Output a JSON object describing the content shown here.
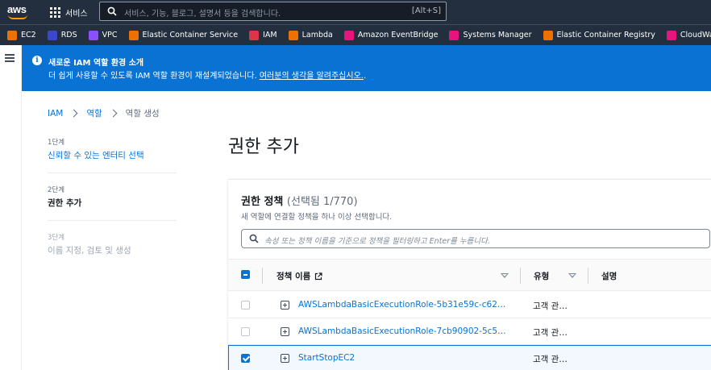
{
  "topnav": {
    "logo_text": "aws",
    "services_label": "서비스",
    "search_placeholder": "서비스, 기능, 블로그, 설명서 등을 검색합니다.",
    "search_shortcut": "[Alt+S]"
  },
  "favorites": [
    {
      "label": "EC2",
      "icon": "ec2-icon",
      "color": "#ed7100"
    },
    {
      "label": "RDS",
      "icon": "rds-icon",
      "color": "#3b48cc"
    },
    {
      "label": "VPC",
      "icon": "vpc-icon",
      "color": "#8c4fff"
    },
    {
      "label": "Elastic Container Service",
      "icon": "ecs-icon",
      "color": "#ed7100"
    },
    {
      "label": "IAM",
      "icon": "iam-icon",
      "color": "#dd344c"
    },
    {
      "label": "Lambda",
      "icon": "lambda-icon",
      "color": "#ed7100"
    },
    {
      "label": "Amazon EventBridge",
      "icon": "eventbridge-icon",
      "color": "#e7157b"
    },
    {
      "label": "Systems Manager",
      "icon": "systems-manager-icon",
      "color": "#e7157b"
    },
    {
      "label": "Elastic Container Registry",
      "icon": "ecr-icon",
      "color": "#ed7100"
    },
    {
      "label": "CloudWatch",
      "icon": "cloudwatch-icon",
      "color": "#e7157b"
    }
  ],
  "flash": {
    "title": "새로운 IAM 역할 환경 소개",
    "body_prefix": "더 쉽게 사용할 수 있도록 IAM 역할 환경이 재설계되었습니다.",
    "link": "여러분의 생각을 알려주십시오.",
    "body_suffix": "."
  },
  "breadcrumb": {
    "items": [
      "IAM",
      "역할"
    ],
    "current": "역할 생성"
  },
  "steps": [
    {
      "num": "1단계",
      "label": "신뢰할 수 있는 엔터티 선택"
    },
    {
      "num": "2단계",
      "label": "권한 추가"
    },
    {
      "num": "3단계",
      "label": "이름 지정, 검토 및 생성"
    }
  ],
  "page_title": "권한 추가",
  "panel": {
    "title": "권한 정책",
    "count": "(선택됨 1/770)",
    "description": "새 역할에 연결할 정책을 하나 이상 선택합니다.",
    "filter_placeholder": "속성 또는 정책 이름을 기준으로 정책을 필터링하고 Enter를 누릅니다.",
    "columns": [
      "정책 이름",
      "유형",
      "설명"
    ]
  },
  "rows": [
    {
      "name": "AWSLambdaBasicExecutionRole-5b31e59c-c626…",
      "type": "고객 관…",
      "selected": false
    },
    {
      "name": "AWSLambdaBasicExecutionRole-7cb90902-5c54…",
      "type": "고객 관…",
      "selected": false
    },
    {
      "name": "StartStopEC2",
      "type": "고객 관…",
      "selected": true
    }
  ]
}
